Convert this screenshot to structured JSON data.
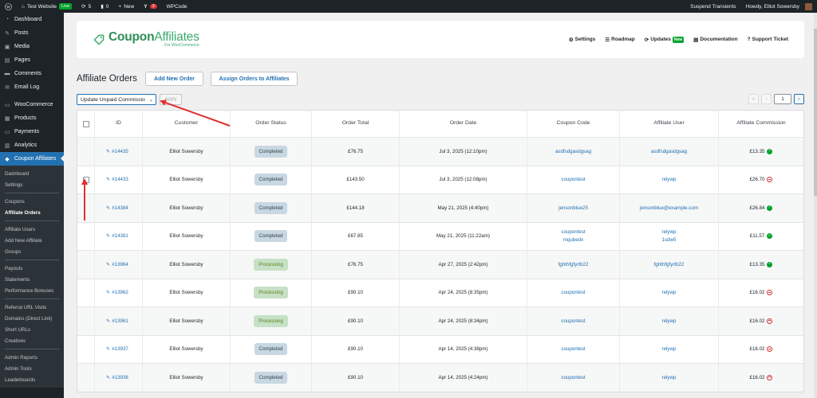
{
  "admin_bar": {
    "site_name": "Test Website",
    "live_badge": "Live",
    "updates_count": "5",
    "comments_count": "0",
    "new_label": "New",
    "yoast_count": "3",
    "wpcode_label": "WPCode",
    "suspend_label": "Suspend Transients",
    "howdy": "Howdy, Elliot Sowersby"
  },
  "sidebar": {
    "items_top": [
      {
        "label": "Dashboard",
        "icon": "dashboard-icon"
      },
      {
        "label": "Posts",
        "icon": "pin-icon"
      },
      {
        "label": "Media",
        "icon": "media-icon"
      },
      {
        "label": "Pages",
        "icon": "page-icon"
      },
      {
        "label": "Comments",
        "icon": "comment-icon"
      },
      {
        "label": "Email Log",
        "icon": "email-icon"
      }
    ],
    "items_mid": [
      {
        "label": "WooCommerce",
        "icon": "woo-icon"
      },
      {
        "label": "Products",
        "icon": "products-icon"
      },
      {
        "label": "Payments",
        "icon": "payments-icon"
      },
      {
        "label": "Analytics",
        "icon": "analytics-icon"
      }
    ],
    "active_item": {
      "label": "Coupon Affiliates",
      "icon": "tag-icon"
    },
    "submenu_groups": [
      [
        "Dashboard",
        "Settings"
      ],
      [
        "Coupons",
        "Affiliate Orders"
      ],
      [
        "Affiliate Users",
        "Add New Affiliate",
        "Groups"
      ],
      [
        "Payouts",
        "Statements",
        "Performance Bonuses"
      ],
      [
        "Referral URL Visits",
        "Domains (Direct Link)",
        "Short URLs",
        "Creatives"
      ],
      [
        "Admin Reports",
        "Admin Tools",
        "Leaderboards"
      ]
    ],
    "current_submenu": "Affiliate Orders"
  },
  "plugin_header": {
    "logo_coupon": "Coupon",
    "logo_affiliates": "Affiliates",
    "logo_sub": "For WooCommerce",
    "nav": [
      {
        "label": "Settings",
        "icon": "gear-icon"
      },
      {
        "label": "Roadmap",
        "icon": "list-icon"
      },
      {
        "label": "Updates",
        "icon": "refresh-icon",
        "badge": "New"
      },
      {
        "label": "Documentation",
        "icon": "book-icon"
      },
      {
        "label": "Support Ticket",
        "icon": "help-icon"
      }
    ]
  },
  "page": {
    "title": "Affiliate Orders",
    "add_new_order": "Add New Order",
    "assign_orders": "Assign Orders to Affiliates",
    "bulk_action": "Update Unpaid Commissio",
    "apply": "Apply",
    "pager": {
      "first": "«",
      "prev": "‹",
      "current": "1",
      "next": "›"
    }
  },
  "table": {
    "headers": [
      "ID",
      "Customer",
      "Order Status",
      "Order Total",
      "Order Date",
      "Coupon Code",
      "Affiliate User",
      "Affiliate Commission"
    ],
    "rows": [
      {
        "id": "#14435",
        "customer": "Elliot Sowersby",
        "status": "Completed",
        "total": "£76.75",
        "date": "Jul 3, 2025 (12:10pm)",
        "coupon": [
          "asdfsdgasdgsag"
        ],
        "user": [
          "asdfsdgasdgsag"
        ],
        "commission": "£13.35",
        "paid": true
      },
      {
        "id": "#14433",
        "customer": "Elliot Sowersby",
        "status": "Completed",
        "total": "£143.50",
        "date": "Jul 3, 2025 (12:08pm)",
        "coupon": [
          "coupontest"
        ],
        "user": [
          "relywp"
        ],
        "commission": "£26.70",
        "paid": false
      },
      {
        "id": "#14384",
        "customer": "Elliot Sowersby",
        "status": "Completed",
        "total": "£144.18",
        "date": "May 21, 2025 (4:40pm)",
        "coupon": [
          "jensonblue25"
        ],
        "user": [
          "jensonblue@example.com"
        ],
        "commission": "£26.84",
        "paid": true
      },
      {
        "id": "#14381",
        "customer": "Elliot Sowersby",
        "status": "Completed",
        "total": "£67.85",
        "date": "May 21, 2025 (11:22am)",
        "coupon": [
          "coupontest",
          "mqubedx"
        ],
        "user": [
          "relywp",
          "1sdw5"
        ],
        "commission": "£11.57",
        "paid": true
      },
      {
        "id": "#13964",
        "customer": "Elliot Sowersby",
        "status": "Processing",
        "total": "£76.75",
        "date": "Apr 27, 2025 (2:42pm)",
        "coupon": [
          "fghthfgfyrtb22"
        ],
        "user": [
          "fghthfgfyrtb22"
        ],
        "commission": "£13.35",
        "paid": true
      },
      {
        "id": "#13962",
        "customer": "Elliot Sowersby",
        "status": "Processing",
        "total": "£90.10",
        "date": "Apr 24, 2025 (8:35pm)",
        "coupon": [
          "coupontest"
        ],
        "user": [
          "relywp"
        ],
        "commission": "£16.02",
        "paid": false
      },
      {
        "id": "#13961",
        "customer": "Elliot Sowersby",
        "status": "Processing",
        "total": "£90.10",
        "date": "Apr 24, 2025 (8:34pm)",
        "coupon": [
          "coupontest"
        ],
        "user": [
          "relywp"
        ],
        "commission": "£16.02",
        "paid": false
      },
      {
        "id": "#13937",
        "customer": "Elliot Sowersby",
        "status": "Completed",
        "total": "£90.10",
        "date": "Apr 14, 2025 (4:38pm)",
        "coupon": [
          "coupontest"
        ],
        "user": [
          "relywp"
        ],
        "commission": "£16.02",
        "paid": false
      },
      {
        "id": "#13936",
        "customer": "Elliot Sowersby",
        "status": "Completed",
        "total": "£90.10",
        "date": "Apr 14, 2025 (4:24pm)",
        "coupon": [
          "coupontest"
        ],
        "user": [
          "relywp"
        ],
        "commission": "£16.02",
        "paid": false
      }
    ],
    "checkbox_rows": [
      1
    ]
  },
  "colors": {
    "accent": "#2271b1",
    "brand_green": "#3aa96b",
    "annotation_red": "#e03030"
  }
}
